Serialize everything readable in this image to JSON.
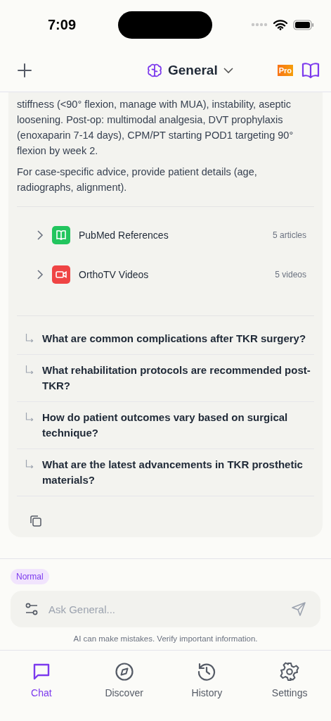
{
  "status_bar": {
    "time": "7:09"
  },
  "header": {
    "title": "General",
    "badge": "Pro"
  },
  "answer": {
    "paragraphs": [
      "stiffness (<90° flexion, manage with MUA), instability, aseptic loosening. Post-op: multimodal analgesia, DVT prophylaxis (enoxaparin 7-14 days), CPM/PT starting POD1 targeting 90° flexion by week 2.",
      "For case-specific advice, provide patient details (age, radiographs, alignment)."
    ]
  },
  "sources": [
    {
      "kind": "articles",
      "label": "PubMed References",
      "count": "5 articles",
      "expanded": false
    },
    {
      "kind": "videos",
      "label": "OrthoTV Videos",
      "count": "5 videos",
      "expanded": false
    }
  ],
  "follow_ups": [
    "What are common complications after TKR surgery?",
    "What rehabilitation protocols are recommended post-TKR?",
    "How do patient outcomes vary based on surgical technique?",
    "What are the latest advancements in TKR prosthetic materials?"
  ],
  "mode": "Normal",
  "input": {
    "placeholder": "Ask General..."
  },
  "disclaimer": "AI can make mistakes. Verify important information.",
  "tabs": [
    {
      "kind": "chat",
      "label": "Chat",
      "selected": true
    },
    {
      "kind": "discover",
      "label": "Discover",
      "selected": false
    },
    {
      "kind": "history",
      "label": "History",
      "selected": false
    },
    {
      "kind": "settings",
      "label": "Settings",
      "selected": false
    }
  ]
}
